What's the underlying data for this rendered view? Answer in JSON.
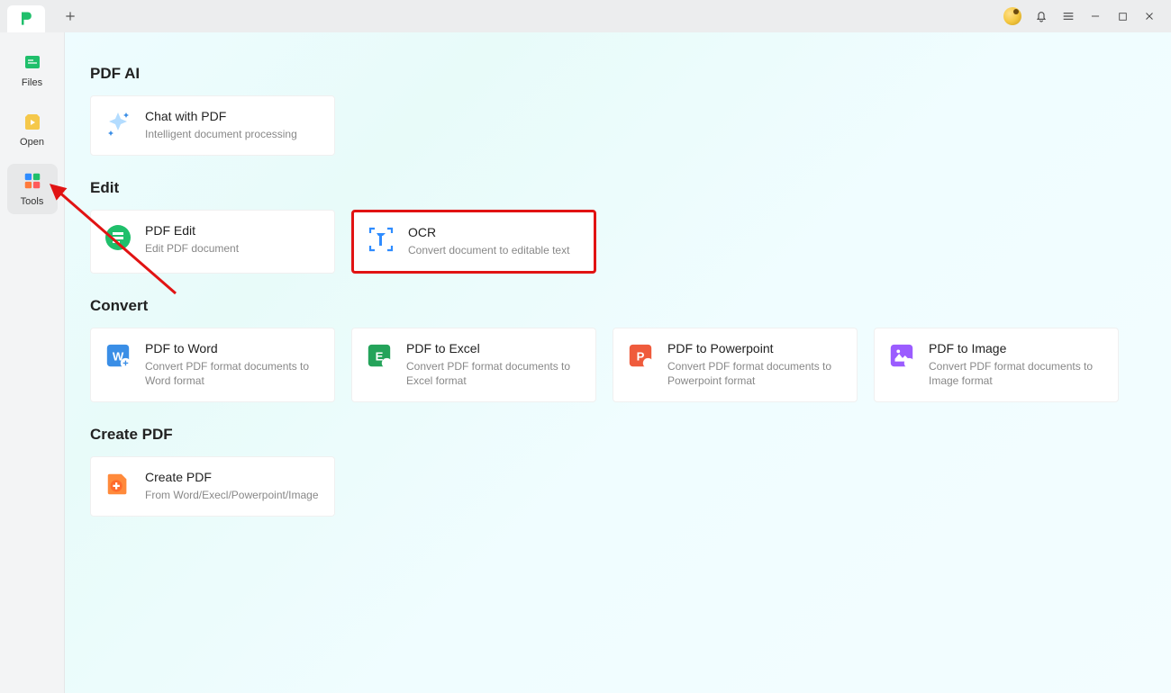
{
  "sidebar": {
    "items": [
      {
        "label": "Files"
      },
      {
        "label": "Open"
      },
      {
        "label": "Tools"
      }
    ]
  },
  "sections": {
    "pdf_ai": {
      "heading": "PDF AI",
      "cards": [
        {
          "title": "Chat with PDF",
          "desc": "Intelligent document processing"
        }
      ]
    },
    "edit": {
      "heading": "Edit",
      "cards": [
        {
          "title": "PDF Edit",
          "desc": "Edit PDF document"
        },
        {
          "title": "OCR",
          "desc": "Convert document to editable text"
        }
      ]
    },
    "convert": {
      "heading": "Convert",
      "cards": [
        {
          "title": "PDF to Word",
          "desc": "Convert PDF format documents to Word format"
        },
        {
          "title": "PDF to Excel",
          "desc": "Convert PDF format documents to Excel format"
        },
        {
          "title": "PDF to Powerpoint",
          "desc": "Convert PDF format documents to Powerpoint format"
        },
        {
          "title": "PDF to Image",
          "desc": "Convert PDF format documents to Image format"
        }
      ]
    },
    "create_pdf": {
      "heading": "Create PDF",
      "cards": [
        {
          "title": "Create PDF",
          "desc": "From Word/Execl/Powerpoint/Image"
        }
      ]
    }
  }
}
